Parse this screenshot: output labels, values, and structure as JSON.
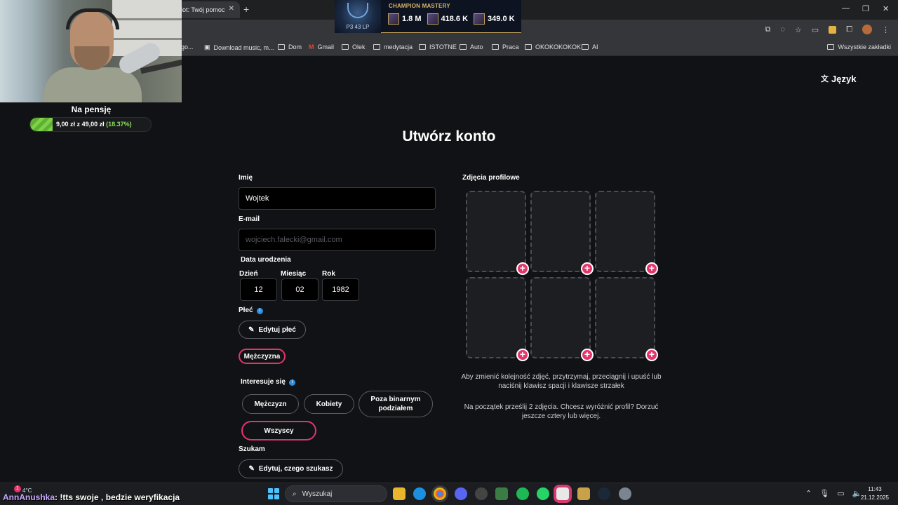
{
  "browser": {
    "tab_title": "lot: Twój pomocn",
    "tab_close": "✕",
    "new_tab": "+",
    "bookmarks": [
      {
        "label": "go...",
        "icon": "none"
      },
      {
        "label": "Download music, m...",
        "icon": "page-icon"
      },
      {
        "label": "Dom",
        "icon": "folder-icon"
      },
      {
        "label": "Gmail",
        "icon": "gmail-icon"
      },
      {
        "label": "Olek",
        "icon": "folder-icon"
      },
      {
        "label": "medytacja",
        "icon": "folder-icon"
      },
      {
        "label": "ISTOTNE",
        "icon": "folder-icon"
      },
      {
        "label": "Auto",
        "icon": "folder-icon"
      },
      {
        "label": "Praca",
        "icon": "folder-icon"
      },
      {
        "label": "OKOKOKOKOK",
        "icon": "folder-icon"
      },
      {
        "label": "AI",
        "icon": "folder-icon"
      }
    ],
    "all_bookmarks": "Wszystkie zakładki"
  },
  "stream_overlay": {
    "pension_title": "Na pensję",
    "pension_amount": "9,00 zł",
    "pension_sep": "z",
    "pension_goal": "49,00 zł",
    "pension_pct": "(18.37%)",
    "pension_fraction": 0.1837,
    "mastery_title": "CHAMPION MASTERY",
    "mastery_lp": "P3 43 LP",
    "mastery_stats": [
      "1.8 M",
      "418.6 K",
      "349.0 K"
    ],
    "chat_user": "AnnAnushka",
    "chat_message": ": !tts swoje , bedzie weryfikacja"
  },
  "page": {
    "language": "Język",
    "title": "Utwórz konto",
    "name_label": "Imię",
    "name_value": "Wojtek",
    "email_label": "E-mail",
    "email_placeholder": "wojciech.falecki@gmail.com",
    "dob_label": "Data urodzenia",
    "day_label": "Dzień",
    "month_label": "Miesiąc",
    "year_label": "Rok",
    "day_value": "12",
    "month_value": "02",
    "year_value": "1982",
    "gender_label": "Płeć",
    "edit_gender": "Edytuj płeć",
    "gender_selected": "Mężczyzna",
    "interested_label": "Interesuje się",
    "interest_options": [
      "Mężczyzn",
      "Kobiety",
      "Poza binarnym podziałem"
    ],
    "interest_selected": "Wszyscy",
    "looking_label": "Szukam",
    "edit_looking": "Edytuj, czego szukasz",
    "photos_label": "Zdjęcia profilowe",
    "photos_hint_1": "Aby zmienić kolejność zdjęć, przytrzymaj, przeciągnij i upuść lub naciśnij klawisz spacji i klawisze strzałek",
    "photos_hint_2": "Na początek prześlij 2 zdjęcia. Chcesz wyróżnić profil? Dorzuć jeszcze cztery lub więcej."
  },
  "taskbar": {
    "weather": "4°C",
    "weather_badge": "1",
    "search": "Wyszukaj",
    "time": "11:43",
    "date": "21.12.2025"
  },
  "colors": {
    "accent": "#e5346b",
    "background": "#111215",
    "info": "#2f8fe0"
  }
}
